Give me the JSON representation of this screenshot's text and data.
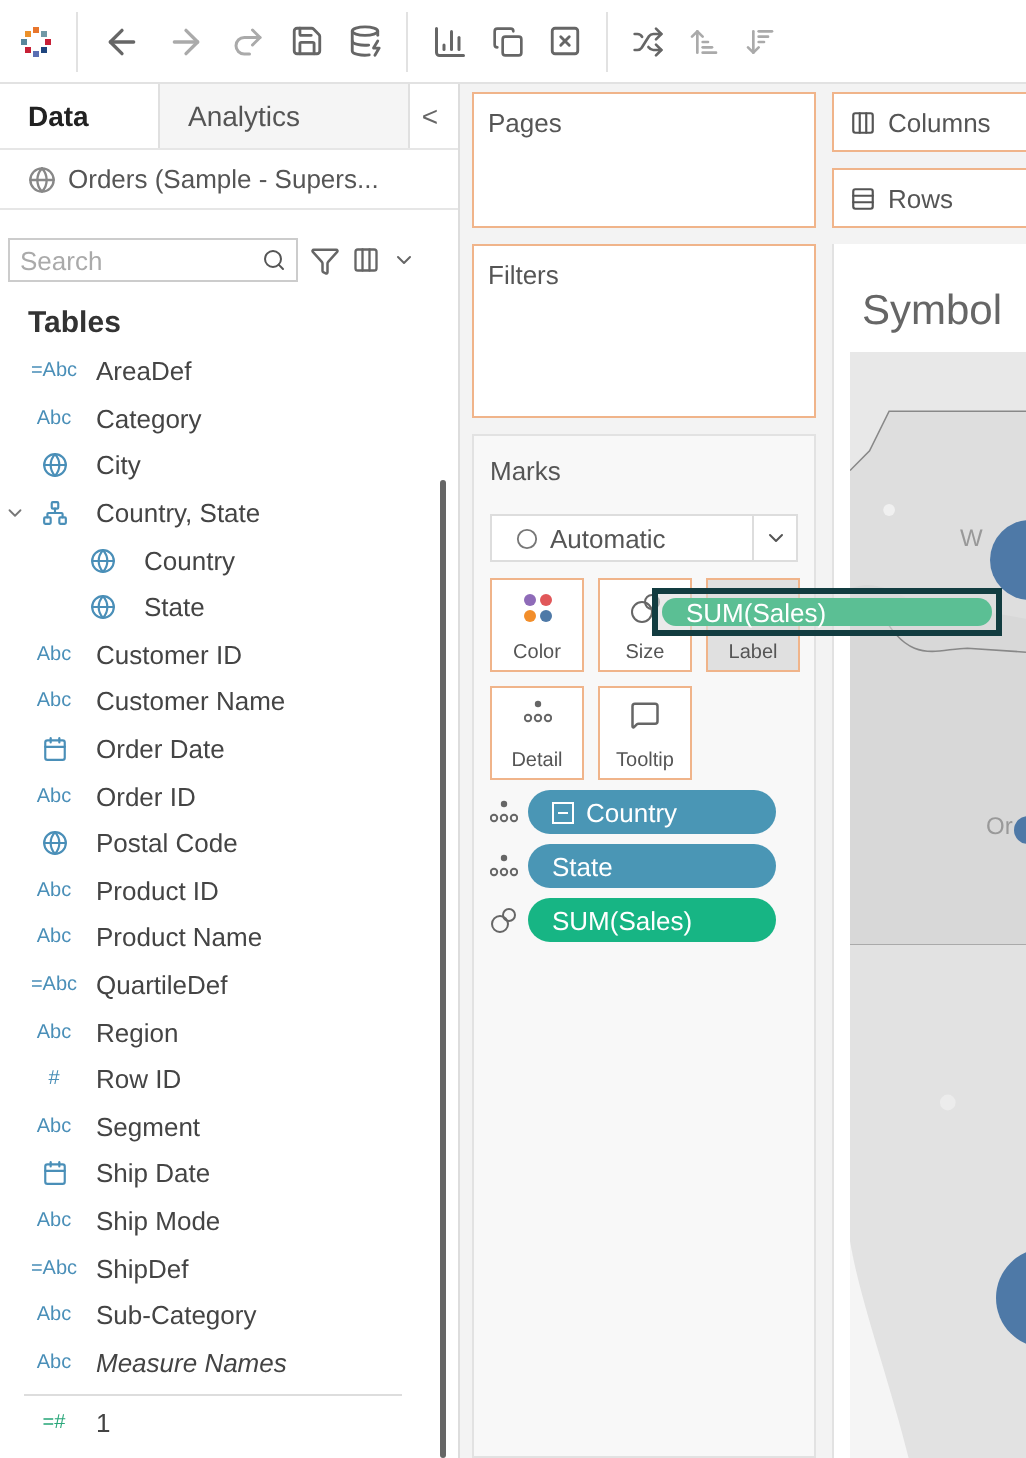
{
  "side_tabs": [
    {
      "label": "Data",
      "selected": true
    },
    {
      "label": "Analytics",
      "selected": false
    }
  ],
  "collapse": "<",
  "data_source": "Orders (Sample - Supers...",
  "search": {
    "placeholder": "Search"
  },
  "tables_heading": "Tables",
  "fields": [
    {
      "kind": "calc_text",
      "icon_text": "=Abc",
      "name": "AreaDef",
      "italic": false
    },
    {
      "kind": "text",
      "icon_text": "Abc",
      "name": "Category",
      "italic": false
    },
    {
      "kind": "geo",
      "name": "City",
      "italic": false
    },
    {
      "kind": "hierarchy",
      "name": "Country, State",
      "italic": false,
      "expanded": true,
      "children": [
        {
          "kind": "geo",
          "name": "Country",
          "italic": false
        },
        {
          "kind": "geo",
          "name": "State",
          "italic": false
        }
      ]
    },
    {
      "kind": "text",
      "icon_text": "Abc",
      "name": "Customer ID",
      "italic": false
    },
    {
      "kind": "text",
      "icon_text": "Abc",
      "name": "Customer Name",
      "italic": false
    },
    {
      "kind": "date",
      "name": "Order Date",
      "italic": false
    },
    {
      "kind": "text",
      "icon_text": "Abc",
      "name": "Order ID",
      "italic": false
    },
    {
      "kind": "geo",
      "name": "Postal Code",
      "italic": false
    },
    {
      "kind": "text",
      "icon_text": "Abc",
      "name": "Product ID",
      "italic": false
    },
    {
      "kind": "text",
      "icon_text": "Abc",
      "name": "Product Name",
      "italic": false
    },
    {
      "kind": "calc_text",
      "icon_text": "=Abc",
      "name": "QuartileDef",
      "italic": false
    },
    {
      "kind": "text",
      "icon_text": "Abc",
      "name": "Region",
      "italic": false
    },
    {
      "kind": "number",
      "icon_text": "#",
      "name": "Row ID",
      "italic": false
    },
    {
      "kind": "text",
      "icon_text": "Abc",
      "name": "Segment",
      "italic": false
    },
    {
      "kind": "date",
      "name": "Ship Date",
      "italic": false
    },
    {
      "kind": "text",
      "icon_text": "Abc",
      "name": "Ship Mode",
      "italic": false
    },
    {
      "kind": "calc_text",
      "icon_text": "=Abc",
      "name": "ShipDef",
      "italic": false
    },
    {
      "kind": "text",
      "icon_text": "Abc",
      "name": "Sub-Category",
      "italic": false
    },
    {
      "kind": "text",
      "icon_text": "Abc",
      "name": "Measure Names",
      "italic": true
    }
  ],
  "measures": [
    {
      "kind": "calc_number",
      "icon_text": "=#",
      "name": "1",
      "italic": false
    }
  ],
  "shelves": {
    "pages": "Pages",
    "filters": "Filters",
    "columns": "Columns",
    "rows": "Rows"
  },
  "marks": {
    "title": "Marks",
    "mark_type": "Automatic",
    "cards": [
      {
        "kind": "color",
        "label": "Color",
        "highlighted": false
      },
      {
        "kind": "size",
        "label": "Size",
        "highlighted": false
      },
      {
        "kind": "label",
        "label": "Label",
        "highlighted": true
      },
      {
        "kind": "detail",
        "label": "Detail",
        "highlighted": false
      },
      {
        "kind": "tooltip",
        "label": "Tooltip",
        "highlighted": false
      }
    ],
    "pills": [
      {
        "kind": "detail",
        "label": "Country",
        "expandable": true,
        "color": "#4a96b5"
      },
      {
        "kind": "detail",
        "label": "State",
        "expandable": false,
        "color": "#4a96b5"
      },
      {
        "kind": "size",
        "label": "SUM(Sales)",
        "expandable": false,
        "color": "#17b584"
      }
    ]
  },
  "drag_pill": "SUM(Sales)",
  "sheet": {
    "title": "Symbol",
    "map_labels": [
      "W",
      "Or"
    ]
  }
}
